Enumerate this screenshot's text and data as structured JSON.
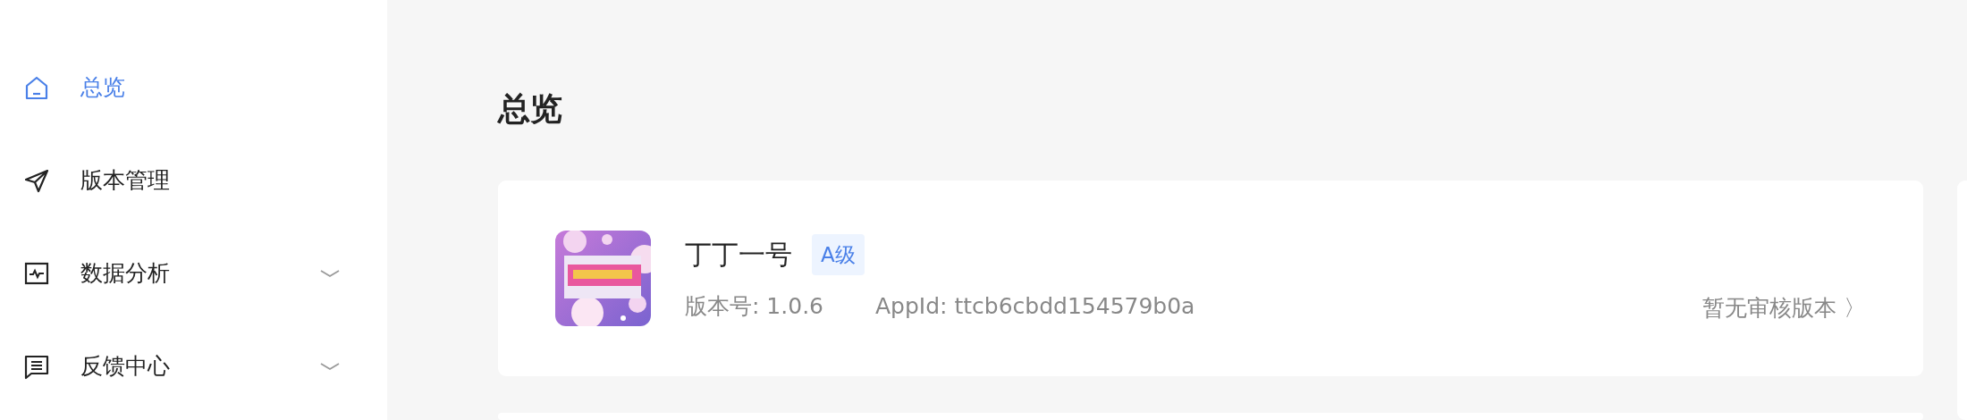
{
  "sidebar": {
    "items": [
      {
        "label": "总览",
        "kind": "link",
        "selected": true
      },
      {
        "label": "版本管理",
        "kind": "link",
        "selected": false
      },
      {
        "label": "数据分析",
        "kind": "group",
        "selected": false,
        "expanded": false
      },
      {
        "label": "反馈中心",
        "kind": "group",
        "selected": false,
        "expanded": false
      }
    ]
  },
  "page": {
    "title": "总览"
  },
  "app_card": {
    "name": "丁丁一号",
    "level_badge": "A级",
    "version": "版本号: 1.0.6",
    "app_id": "AppId: ttcb6cbdd154579b0a",
    "review_link": "暂无审核版本",
    "review_chevron": "〉"
  }
}
